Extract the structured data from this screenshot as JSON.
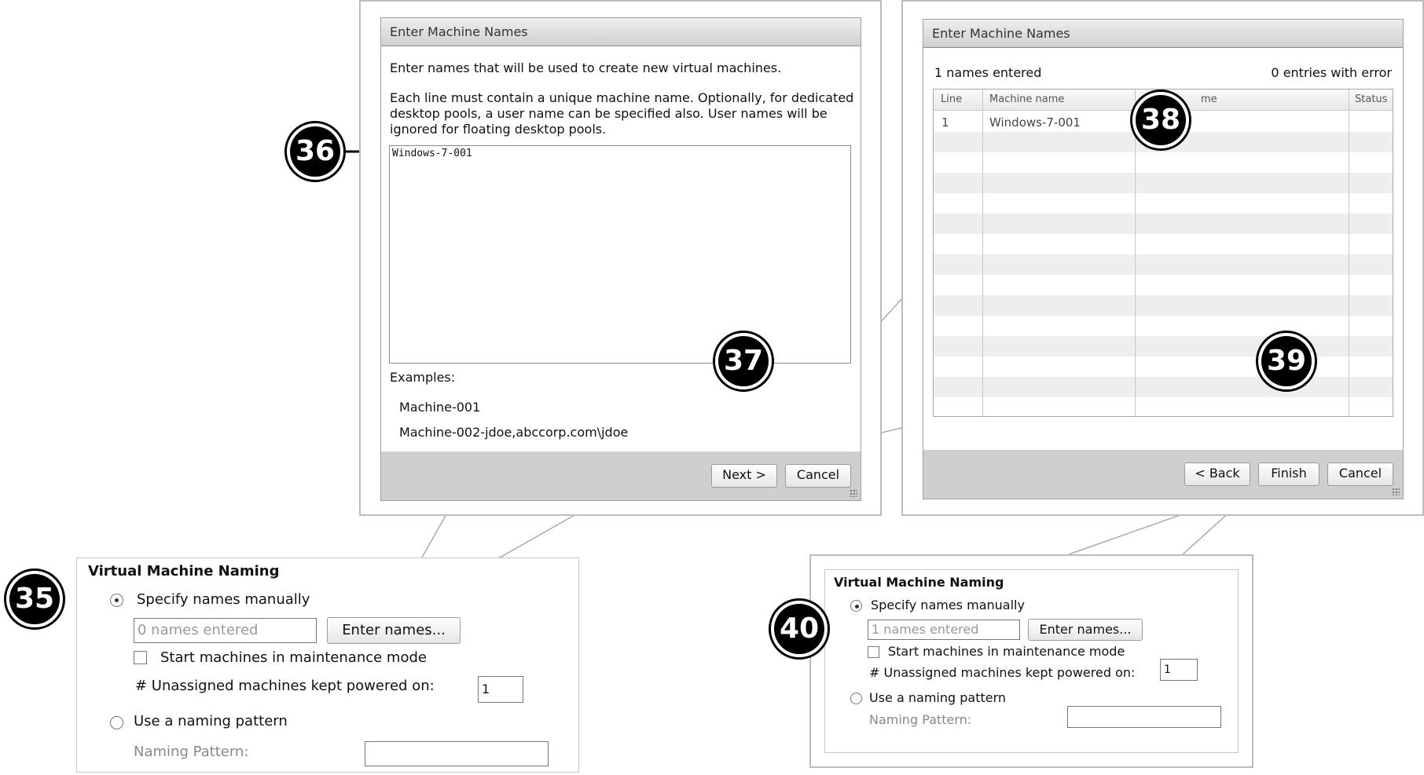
{
  "colors": {
    "callout_bg": "#000000",
    "footer_bg": "#cfcfcf",
    "stripe": "#eeeeee"
  },
  "left_dialog": {
    "title": "Enter Machine Names",
    "intro": "Enter names that will be used to create new virtual machines.",
    "help_line1": "Each line must contain a unique machine name. Optionally, for dedicated",
    "help_line2": "desktop pools, a user name can be specified also. User names will be",
    "help_line3": "ignored for floating desktop pools.",
    "textarea_value": "Windows-7-001",
    "examples_label": "Examples:",
    "example1": "Machine-001",
    "example2": "Machine-002-jdoe,abccorp.com\\jdoe",
    "next_label": "Next >",
    "cancel_label": "Cancel"
  },
  "right_dialog": {
    "title": "Enter Machine Names",
    "names_entered": "1 names entered",
    "entries_error": "0 entries with error",
    "columns": [
      "Line",
      "Machine name",
      "me",
      "Status"
    ],
    "rows": [
      {
        "line": "1",
        "machine": "Windows-7-001"
      }
    ],
    "back_label": "< Back",
    "finish_label": "Finish",
    "cancel_label": "Cancel"
  },
  "naming_before": {
    "title": "Virtual Machine Naming",
    "specify_label": "Specify names manually",
    "names_placeholder": "0 names entered",
    "enter_names_label": "Enter names...",
    "maintenance_label": "Start machines in maintenance mode",
    "unassigned_label": "# Unassigned machines kept powered on:",
    "unassigned_value": "1",
    "pattern_label": "Use a naming pattern",
    "pattern_field_label": "Naming Pattern:"
  },
  "naming_after": {
    "title": "Virtual Machine Naming",
    "specify_label": "Specify names manually",
    "names_placeholder": "1 names entered",
    "enter_names_label": "Enter names...",
    "maintenance_label": "Start machines in maintenance mode",
    "unassigned_label": "# Unassigned machines kept powered on:",
    "unassigned_value": "1",
    "pattern_label": "Use a naming pattern",
    "pattern_field_label": "Naming Pattern:"
  },
  "callouts": {
    "c35": "35",
    "c36": "36",
    "c37": "37",
    "c38": "38",
    "c39": "39",
    "c40": "40"
  }
}
